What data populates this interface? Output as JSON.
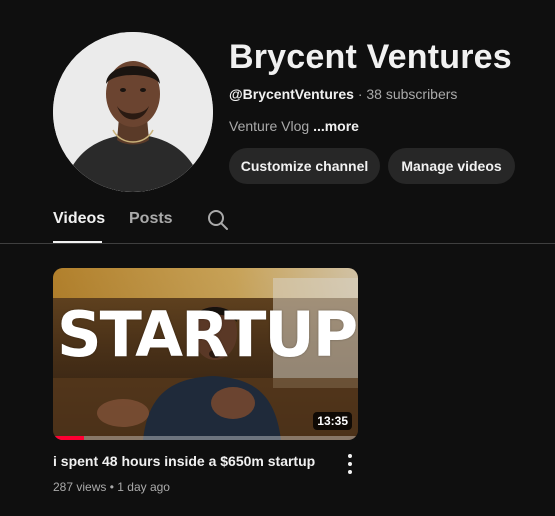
{
  "channel": {
    "name": "Brycent Ventures",
    "handle": "@BrycentVentures",
    "separator": "·",
    "subscribers": "38 subscribers",
    "description": "Venture Vlog",
    "more_label": "...more"
  },
  "actions": {
    "customize_label": "Customize channel",
    "manage_label": "Manage videos"
  },
  "tabs": [
    {
      "label": "Videos",
      "selected": true
    },
    {
      "label": "Posts",
      "selected": false
    }
  ],
  "icons": {
    "search": "search-icon",
    "menu": "more-vert-icon"
  },
  "video": {
    "thumbnail_text": "STARTUP",
    "duration": "13:35",
    "watch_progress": 0.1,
    "title": "i spent 48 hours inside a $650m startup",
    "views": "287 views",
    "separator": "•",
    "age": "1 day ago"
  },
  "colors": {
    "background": "#0f0f0f",
    "button_bg": "#272727",
    "progress": "#ff0033",
    "secondary_text": "#aaaaaa"
  }
}
